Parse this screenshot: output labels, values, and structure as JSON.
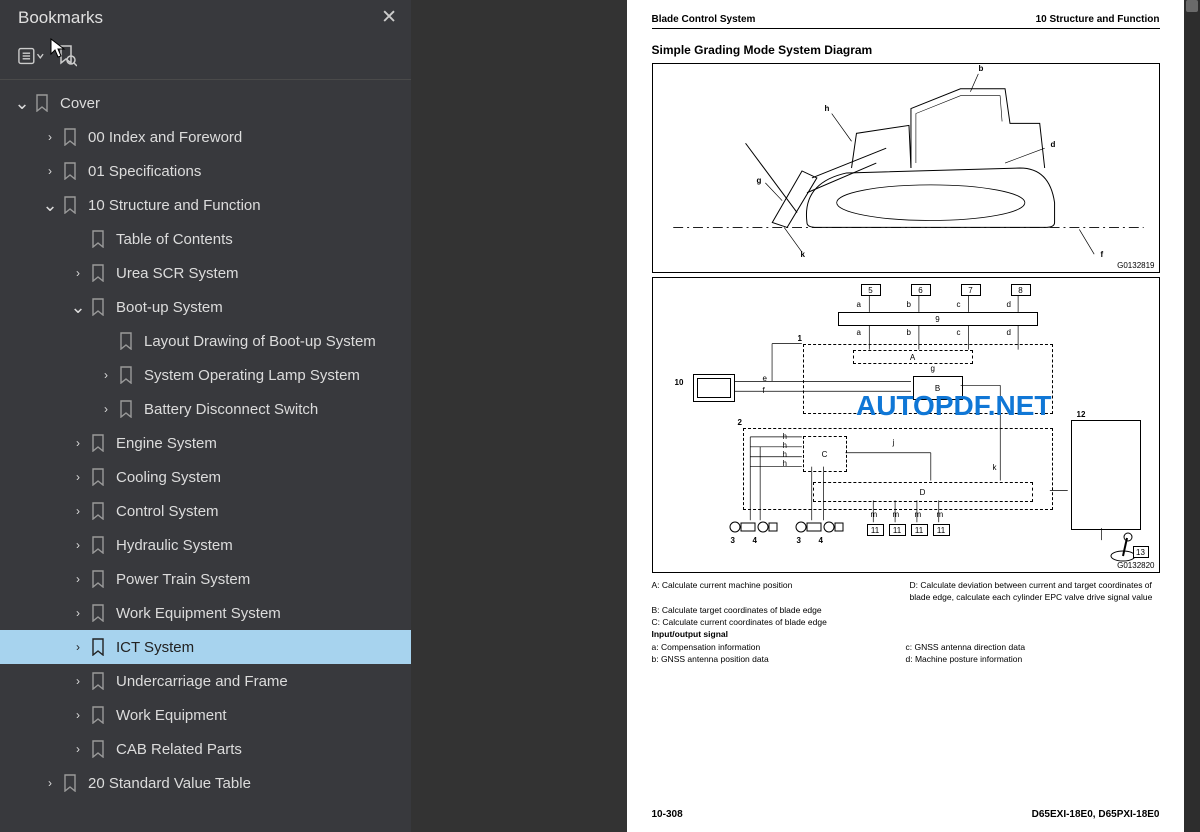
{
  "sidebar": {
    "title": "Bookmarks",
    "items": [
      {
        "label": "Cover",
        "depth": 0,
        "expand": "down",
        "selected": false
      },
      {
        "label": "00 Index and Foreword",
        "depth": 1,
        "expand": "right",
        "selected": false
      },
      {
        "label": "01 Specifications",
        "depth": 1,
        "expand": "right",
        "selected": false
      },
      {
        "label": "10 Structure and Function",
        "depth": 1,
        "expand": "down",
        "selected": false
      },
      {
        "label": "Table of Contents",
        "depth": 2,
        "expand": "none",
        "selected": false
      },
      {
        "label": "Urea SCR System",
        "depth": 2,
        "expand": "right",
        "selected": false
      },
      {
        "label": "Boot-up System",
        "depth": 2,
        "expand": "down",
        "selected": false
      },
      {
        "label": "Layout Drawing of Boot-up System",
        "depth": 3,
        "expand": "none",
        "selected": false
      },
      {
        "label": "System Operating Lamp System",
        "depth": 3,
        "expand": "right",
        "selected": false
      },
      {
        "label": "Battery Disconnect Switch",
        "depth": 3,
        "expand": "right",
        "selected": false
      },
      {
        "label": "Engine System",
        "depth": 2,
        "expand": "right",
        "selected": false
      },
      {
        "label": "Cooling System",
        "depth": 2,
        "expand": "right",
        "selected": false
      },
      {
        "label": "Control System",
        "depth": 2,
        "expand": "right",
        "selected": false
      },
      {
        "label": "Hydraulic System",
        "depth": 2,
        "expand": "right",
        "selected": false
      },
      {
        "label": "Power Train System",
        "depth": 2,
        "expand": "right",
        "selected": false
      },
      {
        "label": "Work Equipment System",
        "depth": 2,
        "expand": "right",
        "selected": false
      },
      {
        "label": "ICT System",
        "depth": 2,
        "expand": "right",
        "selected": true
      },
      {
        "label": "Undercarriage and Frame",
        "depth": 2,
        "expand": "right",
        "selected": false
      },
      {
        "label": "Work Equipment",
        "depth": 2,
        "expand": "right",
        "selected": false
      },
      {
        "label": "CAB Related Parts",
        "depth": 2,
        "expand": "right",
        "selected": false
      },
      {
        "label": "20 Standard Value Table",
        "depth": 1,
        "expand": "right",
        "selected": false
      }
    ]
  },
  "watermark": "AUTOPDF.NET",
  "page": {
    "header_left": "Blade Control System",
    "header_right": "10 Structure and Function",
    "section_title": "Simple Grading Mode System Diagram",
    "fig1_id": "G0132819",
    "fig2_id": "G0132820",
    "fig1_labels": {
      "b": "b",
      "h": "h",
      "d": "d",
      "g": "g",
      "k": "k",
      "f": "f"
    },
    "schematic": {
      "top_boxes": [
        "5",
        "6",
        "7",
        "8"
      ],
      "arrows_top": [
        "a",
        "b",
        "c",
        "d"
      ],
      "block9": "9",
      "arrows_mid": [
        "a",
        "b",
        "c",
        "d"
      ],
      "dashed1": "1",
      "A": "A",
      "B": "B",
      "C": "C",
      "D": "D",
      "g": "g",
      "e": "e",
      "f": "f",
      "box10": "10",
      "dashed2": "2",
      "box12": "12",
      "h_labels": [
        "h",
        "h",
        "h",
        "h"
      ],
      "j": "j",
      "k": "k",
      "triplets": [
        "3",
        "4",
        "3",
        "4"
      ],
      "m_labels": [
        "m",
        "m",
        "m",
        "m"
      ],
      "eleven": [
        "11",
        "11",
        "11",
        "11"
      ],
      "joystick": "13"
    },
    "legend": {
      "A": "A: Calculate current machine position",
      "B": "B: Calculate target coordinates of blade edge",
      "C": "C: Calculate current coordinates of blade edge",
      "D": "D: Calculate deviation between current and target coordinates of blade edge, calculate each cylinder EPC valve drive signal value",
      "io_head": "Input/output signal",
      "a": "a: Compensation information",
      "b": "b: GNSS antenna position data",
      "c": "c: GNSS antenna direction data",
      "d": "d: Machine posture information"
    },
    "footer_left": "10-308",
    "footer_right": "D65EXI-18E0, D65PXI-18E0"
  }
}
